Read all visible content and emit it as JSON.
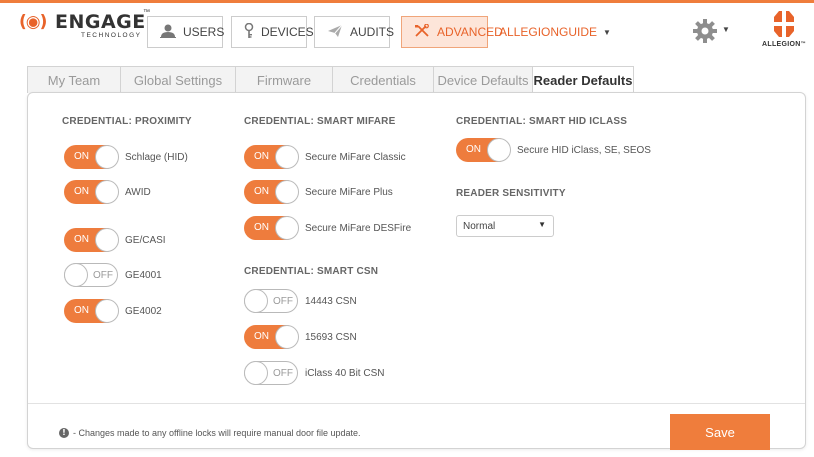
{
  "header": {
    "logo_mark": "(◉)",
    "logo_word": "ENGAGE",
    "logo_tm": "™",
    "logo_sub": "TECHNOLOGY",
    "nav": {
      "users": "USERS",
      "devices": "DEVICES",
      "audits": "AUDITS",
      "advanced": "ADVANCED"
    },
    "user_name": "ALLEGIONGUIDE",
    "brand": "ALLEGION",
    "brand_tm": "™"
  },
  "tabs": [
    {
      "label": "My Team",
      "active": false
    },
    {
      "label": "Global Settings",
      "active": false
    },
    {
      "label": "Firmware",
      "active": false
    },
    {
      "label": "Credentials",
      "active": false
    },
    {
      "label": "Device Defaults",
      "active": false
    },
    {
      "label": "Reader Defaults",
      "active": true
    }
  ],
  "sections": {
    "proximity": {
      "title": "CREDENTIAL: PROXIMITY",
      "items": [
        {
          "label": "Schlage (HID)",
          "state": "ON"
        },
        {
          "label": "AWID",
          "state": "ON"
        },
        {
          "label": "GE/CASI",
          "state": "ON"
        },
        {
          "label": "GE4001",
          "state": "OFF"
        },
        {
          "label": "GE4002",
          "state": "ON"
        }
      ]
    },
    "mifare": {
      "title": "CREDENTIAL: SMART MIFARE",
      "items": [
        {
          "label": "Secure MiFare Classic",
          "state": "ON"
        },
        {
          "label": "Secure MiFare Plus",
          "state": "ON"
        },
        {
          "label": "Secure MiFare DESFire",
          "state": "ON"
        }
      ]
    },
    "csn": {
      "title": "CREDENTIAL: SMART CSN",
      "items": [
        {
          "label": "14443 CSN",
          "state": "OFF"
        },
        {
          "label": "15693 CSN",
          "state": "ON"
        },
        {
          "label": "iClass 40 Bit CSN",
          "state": "OFF"
        }
      ]
    },
    "hid_iclass": {
      "title": "CREDENTIAL: SMART HID ICLASS",
      "items": [
        {
          "label": "Secure HID iClass, SE, SEOS",
          "state": "ON"
        }
      ]
    },
    "sensitivity": {
      "title": "READER SENSITIVITY",
      "selected": "Normal"
    }
  },
  "footer": {
    "note": "- Changes made to any offline locks will require manual door file update.",
    "info_glyph": "!",
    "save_label": "Save"
  },
  "colors": {
    "accent": "#ee7c3d",
    "text": "#555555"
  }
}
